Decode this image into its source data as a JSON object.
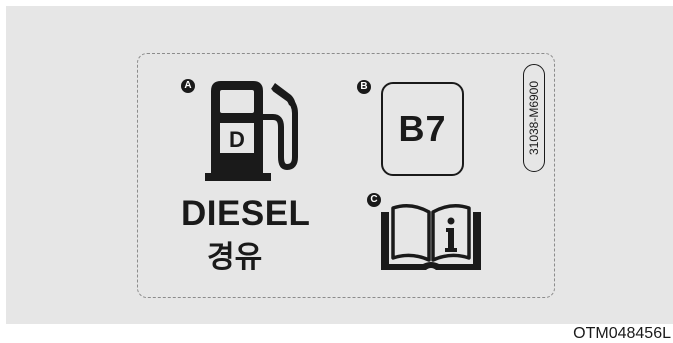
{
  "label": {
    "fuel_type": "DIESEL",
    "fuel_type_korean": "경유",
    "blend_grade": "B7",
    "pump_letter": "D",
    "part_number": "31038-M6900",
    "callouts": {
      "a": "A",
      "b": "B",
      "c": "C"
    },
    "manual_icon": "owners-manual-info-icon",
    "pump_icon": "fuel-pump-icon"
  },
  "image_code": "OTM048456L",
  "colors": {
    "ink": "#1a1a1a",
    "background": "#e6e6e6"
  }
}
